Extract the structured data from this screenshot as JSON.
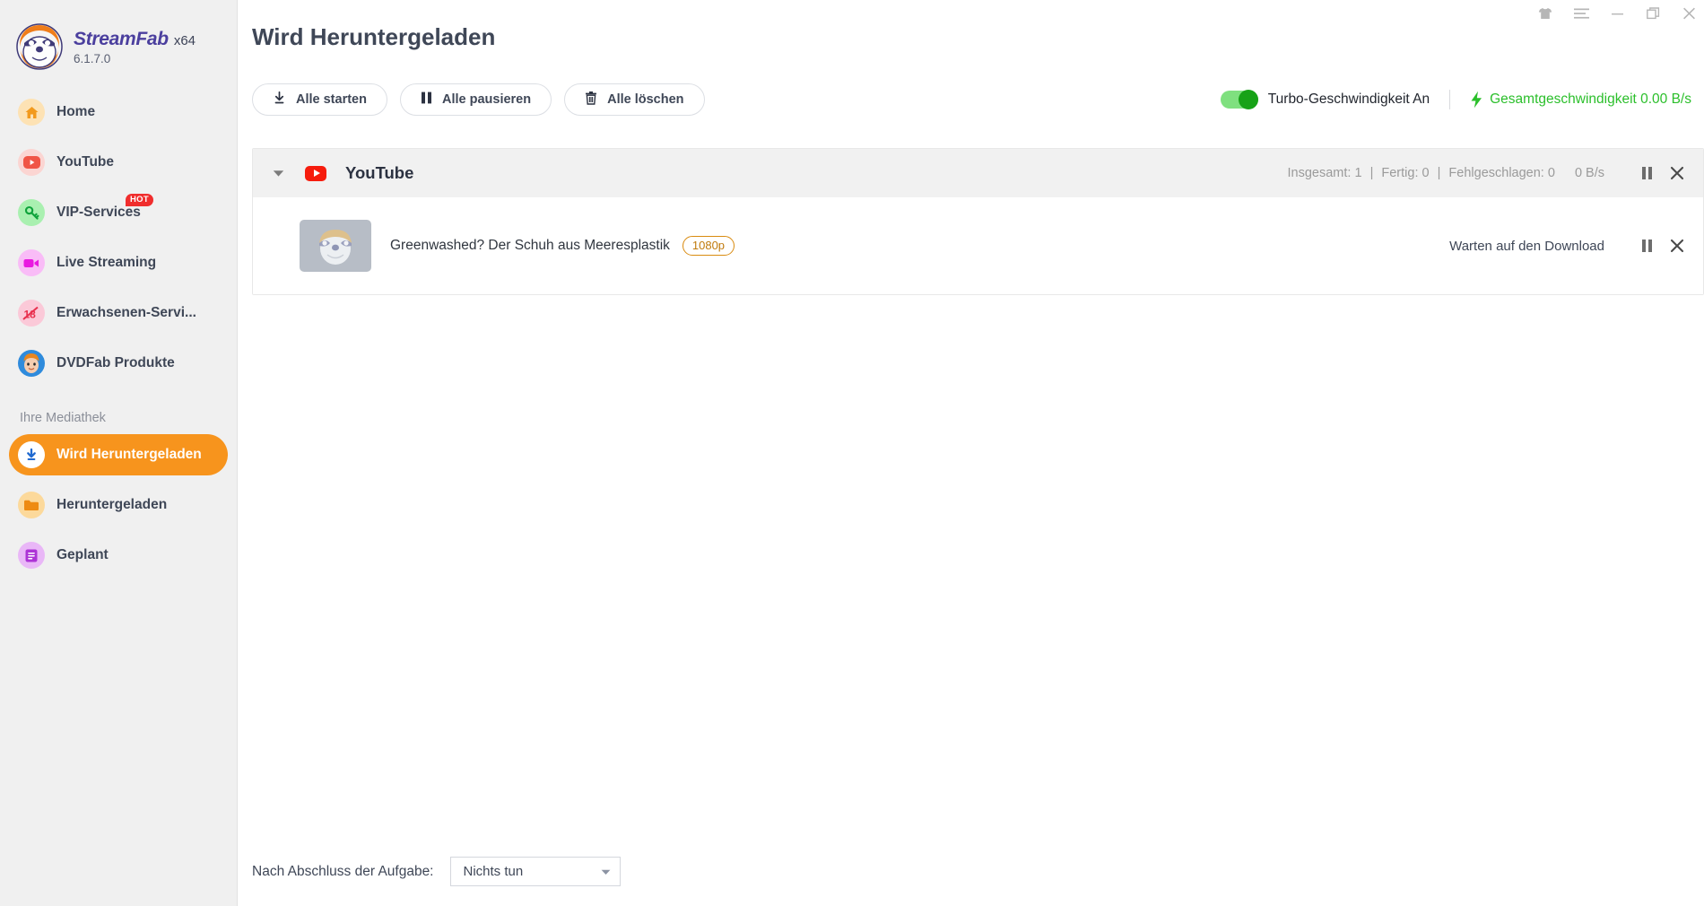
{
  "app": {
    "brand_name": "StreamFab",
    "arch": "x64",
    "version": "6.1.7.0"
  },
  "window_controls": [
    {
      "name": "theme-shirt-icon",
      "label": "Theme"
    },
    {
      "name": "menu-icon",
      "label": "Menu"
    },
    {
      "name": "minimize-icon",
      "label": "Minimieren"
    },
    {
      "name": "maximize-icon",
      "label": "Maximieren"
    },
    {
      "name": "close-icon",
      "label": "Schließen"
    }
  ],
  "sidebar": {
    "items": [
      {
        "label": "Home",
        "icon": "home-icon",
        "active": false,
        "badge": null
      },
      {
        "label": "YouTube",
        "icon": "youtube-icon",
        "active": false,
        "badge": null
      },
      {
        "label": "VIP-Services",
        "icon": "key-icon",
        "active": false,
        "badge": "HOT"
      },
      {
        "label": "Live Streaming",
        "icon": "video-camera-icon",
        "active": false,
        "badge": null
      },
      {
        "label": "Erwachsenen-Servi...",
        "icon": "adult-18-plus-icon",
        "active": false,
        "badge": null
      },
      {
        "label": "DVDFab Produkte",
        "icon": "dvdfab-icon",
        "active": false,
        "badge": null
      }
    ],
    "section_label": "Ihre Mediathek",
    "library_items": [
      {
        "label": "Wird Heruntergeladen",
        "icon": "download-circle-icon",
        "active": true
      },
      {
        "label": "Heruntergeladen",
        "icon": "folder-icon",
        "active": false
      },
      {
        "label": "Geplant",
        "icon": "calendar-list-icon",
        "active": false
      }
    ]
  },
  "header": {
    "title": "Wird Heruntergeladen"
  },
  "toolbar": {
    "start_all": "Alle starten",
    "pause_all": "Alle pausieren",
    "delete_all": "Alle löschen",
    "turbo_label": "Turbo-Geschwindigkeit An",
    "turbo_on": true,
    "total_speed": "Gesamtgeschwindigkeit 0.00 B/s"
  },
  "group": {
    "name": "YouTube",
    "expanded": true,
    "stats_total_label": "Insgesamt:",
    "stats_total_value": "1",
    "stats_done_label": "Fertig:",
    "stats_done_value": "0",
    "stats_failed_label": "Fehlgeschlagen:",
    "stats_failed_value": "0",
    "speed": "0 B/s"
  },
  "tasks": [
    {
      "title": "Greenwashed? Der Schuh aus Meeresplastik",
      "quality": "1080p",
      "status": "Warten auf den Download"
    }
  ],
  "bottom_bar": {
    "label": "Nach Abschluss der Aufgabe:",
    "selected_option": "Nichts tun"
  },
  "colors": {
    "accent_orange": "#f7941d",
    "brand_purple": "#4b3f9e",
    "youtube_red": "#f61c0d",
    "green_speed": "#2bbf2b",
    "toggle_green": "#17a217",
    "quality_border": "#d98b10",
    "sidebar_bg": "#f0f0f0"
  }
}
